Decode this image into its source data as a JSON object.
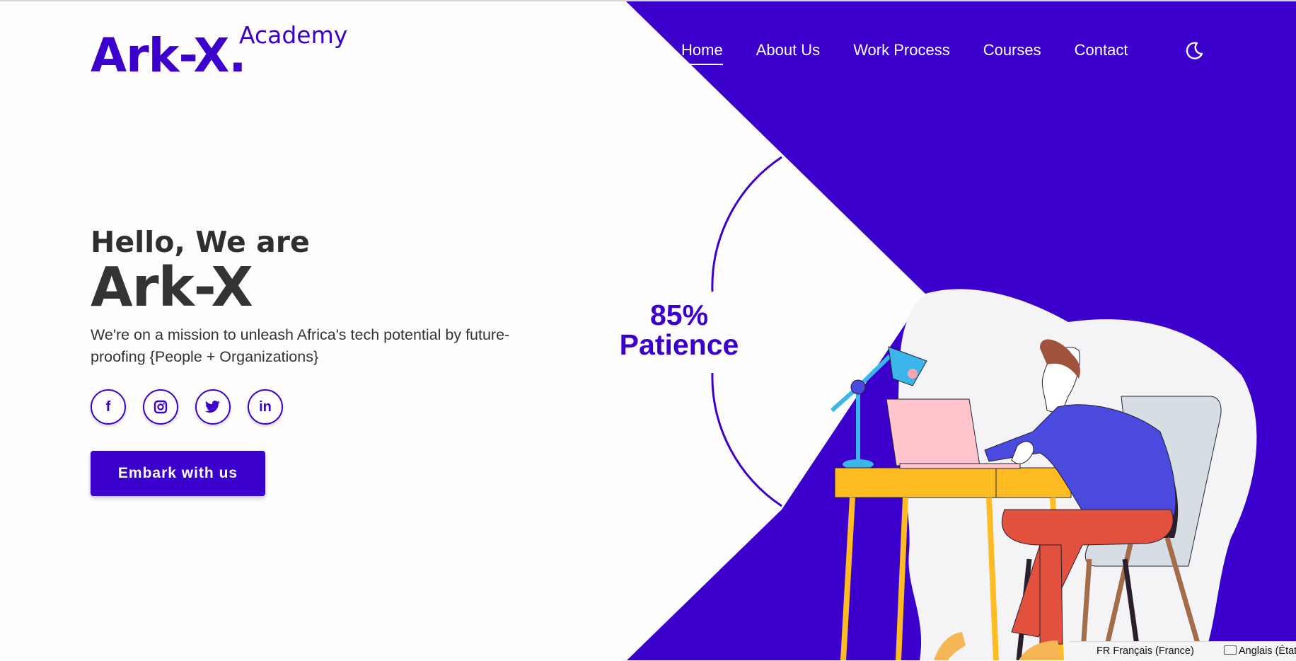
{
  "colors": {
    "brand": "#3c00cc",
    "text": "#333333",
    "background": "#fdfdfd"
  },
  "logo": {
    "main": "Ark-X.",
    "sub": "Academy"
  },
  "nav": {
    "items": [
      {
        "label": "Home",
        "active": true
      },
      {
        "label": "About Us",
        "active": false
      },
      {
        "label": "Work Process",
        "active": false
      },
      {
        "label": "Courses",
        "active": false
      },
      {
        "label": "Contact",
        "active": false
      }
    ],
    "theme_toggle_icon": "moon-icon"
  },
  "hero": {
    "greeting": "Hello, We are",
    "title": "Ark-X",
    "description": "We're on a mission to unleash Africa's tech potential by future-proofing {People + Organizations}",
    "cta_label": "Embark with us"
  },
  "socials": [
    {
      "name": "facebook-icon",
      "glyph": "f"
    },
    {
      "name": "instagram-icon",
      "glyph": ""
    },
    {
      "name": "twitter-icon",
      "glyph": ""
    },
    {
      "name": "linkedin-icon",
      "glyph": "in"
    }
  ],
  "stat": {
    "value": "85%",
    "label": "Patience"
  },
  "taskbar": {
    "language_primary": "FR Français (France)",
    "language_secondary": "Anglais (États"
  }
}
